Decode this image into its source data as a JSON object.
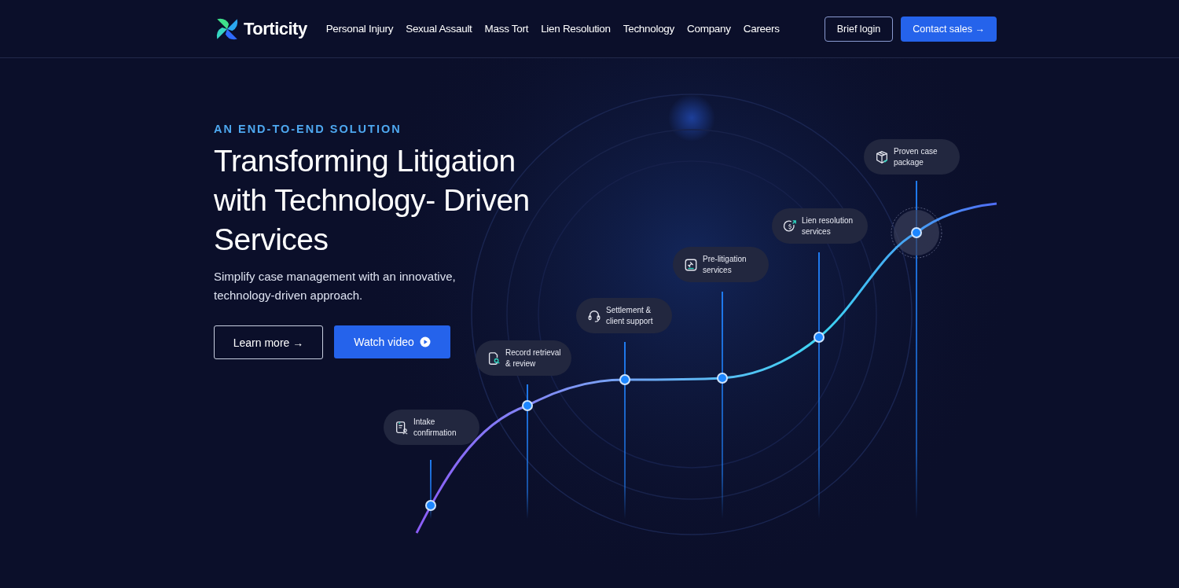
{
  "brand": {
    "name": "Torticity"
  },
  "nav": {
    "links": [
      "Personal Injury",
      "Sexual Assault",
      "Mass Tort",
      "Lien Resolution",
      "Technology",
      "Company",
      "Careers"
    ],
    "login": "Brief login",
    "cta": "Contact sales →"
  },
  "hero": {
    "eyebrow": "AN END-TO-END SOLUTION",
    "title": "Transforming Litigation with Technology- Driven Services",
    "subtitle": "Simplify case management with an innovative, technology-driven approach.",
    "buttons": [
      {
        "kind": "outline",
        "label": "Learn more →"
      },
      {
        "kind": "video",
        "label": "Watch video"
      }
    ]
  },
  "steps": [
    {
      "label": "Intake confirmation",
      "kind": "document",
      "highlighted": false
    },
    {
      "label": "Record retrieval & review",
      "kind": "search",
      "highlighted": false
    },
    {
      "label": "Settlement & client support",
      "kind": "headset",
      "highlighted": false
    },
    {
      "label": "Pre-litigation services",
      "kind": "gavel",
      "highlighted": false
    },
    {
      "label": "Lien resolution services",
      "kind": "dollar",
      "highlighted": false
    },
    {
      "label": "Proven case package",
      "kind": "box",
      "highlighted": true
    }
  ]
}
